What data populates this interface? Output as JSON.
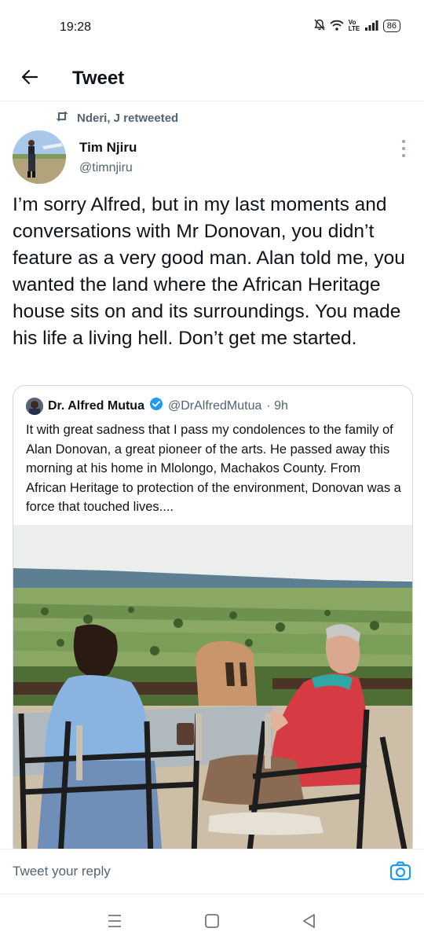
{
  "status_bar": {
    "time": "19:28",
    "network_label": "Vo LTE",
    "battery": "86"
  },
  "header": {
    "title": "Tweet",
    "back_icon": "arrow-left-icon"
  },
  "tweet": {
    "retweeted_by": "Nderi, J retweeted",
    "author_name": "Tim Njiru",
    "author_handle": "@timnjiru",
    "text": "I’m sorry Alfred, but in my last moments and conversations with Mr Donovan, you didn’t feature as a very good man. Alan told me, you wanted the land where the African Heritage house sits on and its surroundings. You made his life a living hell. Don’t get me started."
  },
  "quoted_tweet": {
    "author_name": "Dr. Alfred Mutua",
    "author_handle": "@DrAlfredMutua",
    "time": "· 9h",
    "verified": true,
    "text": "It with great sadness that I pass my condolences to the family of Alan Donovan, a great pioneer of the arts. He passed away this morning at his home in Mlolongo, Machakos County. From African Heritage to protection of the environment, Donovan was a force that touched lives...."
  },
  "reply": {
    "placeholder": "Tweet your reply"
  },
  "colors": {
    "accent": "#1d9bf0",
    "secondary_text": "#536471",
    "primary_text": "#0f1419"
  }
}
